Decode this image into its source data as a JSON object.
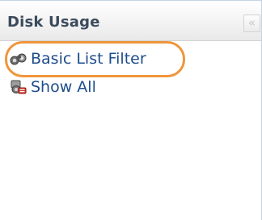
{
  "panel": {
    "title": "Disk Usage",
    "collapse_glyph": "«"
  },
  "items": [
    {
      "label": "Basic List Filter",
      "icon": "filter-binoculars-icon"
    },
    {
      "label": "Show All",
      "icon": "show-all-icon"
    }
  ],
  "colors": {
    "link": "#1d4d8c",
    "highlight": "#f0953a",
    "header_text": "#3b4b5c"
  }
}
